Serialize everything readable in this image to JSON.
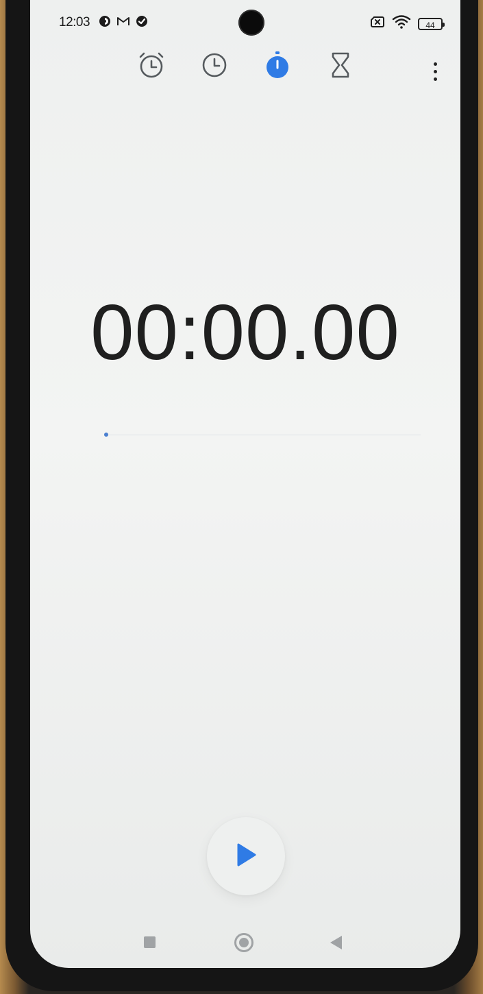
{
  "status_bar": {
    "time": "12:03",
    "left_icons": [
      "vpn-key-icon",
      "gmail-icon",
      "check-circle-icon"
    ],
    "right_icons": [
      "sim-off-icon",
      "wifi-icon",
      "battery-icon"
    ],
    "battery_level": "44"
  },
  "tabs": [
    {
      "name": "alarm",
      "icon": "alarm-clock-icon",
      "selected": false
    },
    {
      "name": "clock",
      "icon": "clock-icon",
      "selected": false
    },
    {
      "name": "stopwatch",
      "icon": "stopwatch-icon",
      "selected": true
    },
    {
      "name": "timer",
      "icon": "hourglass-icon",
      "selected": false
    }
  ],
  "stopwatch": {
    "elapsed": "00:00.00",
    "progress": 0
  },
  "controls": {
    "start_icon": "play-icon"
  },
  "colors": {
    "accent": "#2f7be5",
    "icon": "#555a5e",
    "text": "#1f1f1f",
    "background": "#f0f2f1"
  }
}
